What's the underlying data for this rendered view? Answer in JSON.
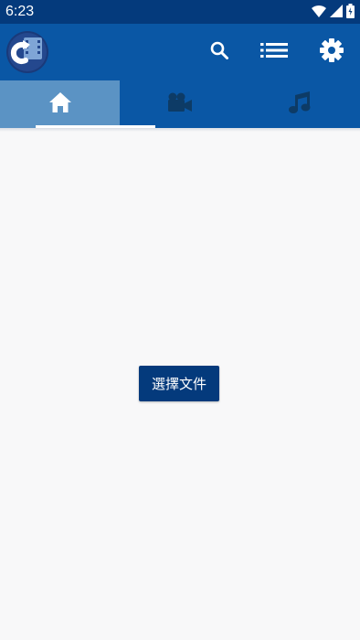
{
  "status_bar": {
    "time": "6:23",
    "icons": [
      "wifi-icon",
      "signal-icon",
      "battery-icon"
    ]
  },
  "app_bar": {
    "logo": "app-logo",
    "actions": [
      "search-icon",
      "list-icon",
      "settings-icon"
    ]
  },
  "tabs": [
    {
      "icon": "home-icon",
      "active": true
    },
    {
      "icon": "video-camera-icon",
      "active": false
    },
    {
      "icon": "music-note-icon",
      "active": false
    }
  ],
  "main": {
    "select_file_label": "選擇文件"
  },
  "colors": {
    "status_bar": "#043a7c",
    "app_bar": "#0a57a5",
    "active_tab": "#5b93c4",
    "tab_icon_inactive": "#0d3b66",
    "button": "#043a7c",
    "background": "#f8f8f9"
  }
}
